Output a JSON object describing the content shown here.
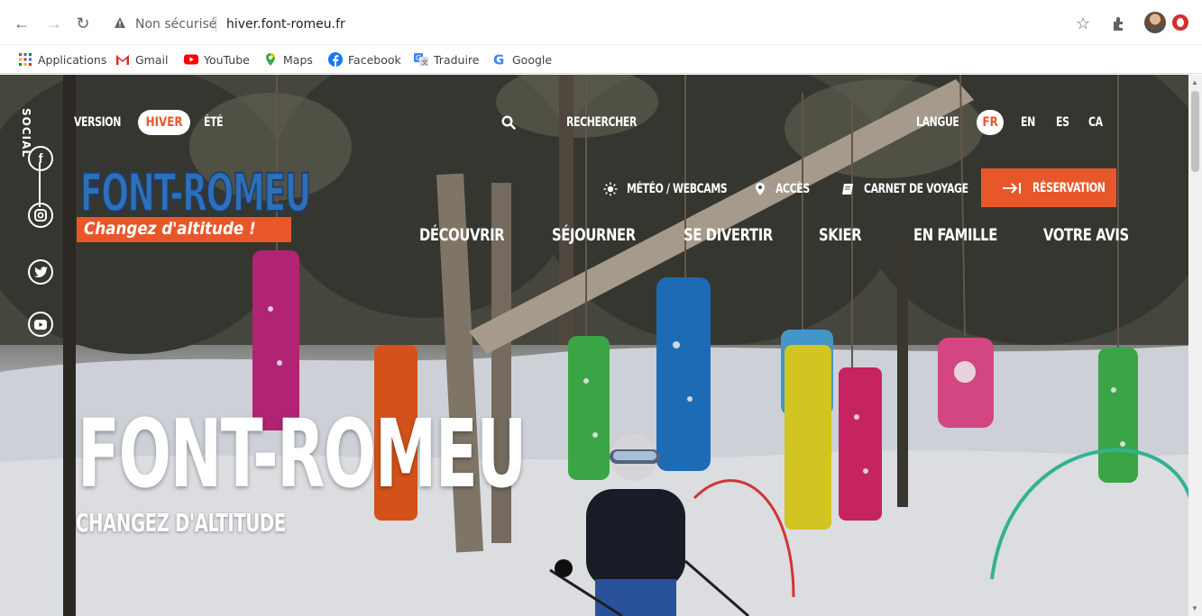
{
  "browser": {
    "security_label": "Non sécurisé",
    "url": "hiver.font-romeu.fr",
    "bookmarks": [
      "Applications",
      "Gmail",
      "YouTube",
      "Maps",
      "Facebook",
      "Traduire",
      "Google"
    ]
  },
  "site": {
    "social_label": "SOCIAL",
    "version_label": "VERSION",
    "season_active": "HIVER",
    "season_other": "ÉTÉ",
    "search_label": "RECHERCHER",
    "language_label": "LANGUE",
    "languages": [
      "FR",
      "EN",
      "ES",
      "CA"
    ],
    "logo": {
      "name": "FONT-ROMEU",
      "tagline": "Changez d'altitude !"
    },
    "utility": [
      "MÉTÉO / WEBCAMS",
      "ACCÈS",
      "CARNET DE VOYAGE"
    ],
    "reservation_label": "RÉSERVATION",
    "menu": [
      "DÉCOUVRIR",
      "SÉJOURNER",
      "SE DIVERTIR",
      "SKIER",
      "EN FAMILLE",
      "VOTRE AVIS"
    ],
    "hero_title": "FONT-ROMEU",
    "hero_subtitle": "CHANGEZ D'ALTITUDE",
    "accent_color": "#e8572a",
    "logo_blue": "#2f6fb7"
  }
}
